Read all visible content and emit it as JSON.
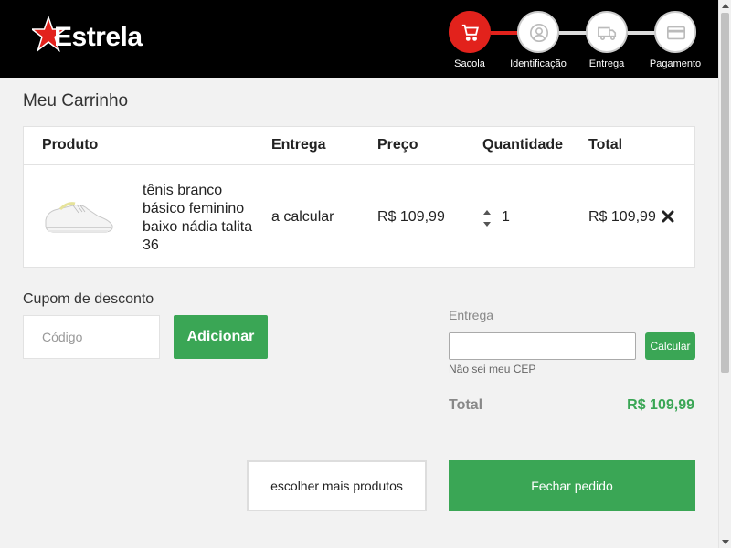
{
  "header": {
    "logo_text": "Estrela",
    "steps": [
      {
        "label": "Sacola",
        "icon": "cart-icon",
        "active": true
      },
      {
        "label": "Identificação",
        "icon": "user-icon",
        "active": false
      },
      {
        "label": "Entrega",
        "icon": "truck-icon",
        "active": false
      },
      {
        "label": "Pagamento",
        "icon": "credit-card-icon",
        "active": false
      }
    ]
  },
  "colors": {
    "accent_red": "#e2221c",
    "accent_green": "#3aa655",
    "header_bg": "#000000"
  },
  "page": {
    "title": "Meu Carrinho"
  },
  "cart": {
    "columns": [
      "Produto",
      "Entrega",
      "Preço",
      "Quantidade",
      "Total"
    ],
    "items": [
      {
        "name": "tênis branco básico feminino baixo nádia talita 36",
        "delivery": "a calcular",
        "price": "R$ 109,99",
        "quantity": "1",
        "total": "R$ 109,99"
      }
    ]
  },
  "coupon": {
    "label": "Cupom de desconto",
    "placeholder": "Código",
    "button": "Adicionar"
  },
  "shipping": {
    "label": "Entrega",
    "value": "",
    "button": "Calcular",
    "link": "Não sei meu CEP"
  },
  "summary": {
    "total_label": "Total",
    "total_value": "R$ 109,99"
  },
  "actions": {
    "more_products": "escolher mais produtos",
    "checkout": "Fechar pedido"
  }
}
